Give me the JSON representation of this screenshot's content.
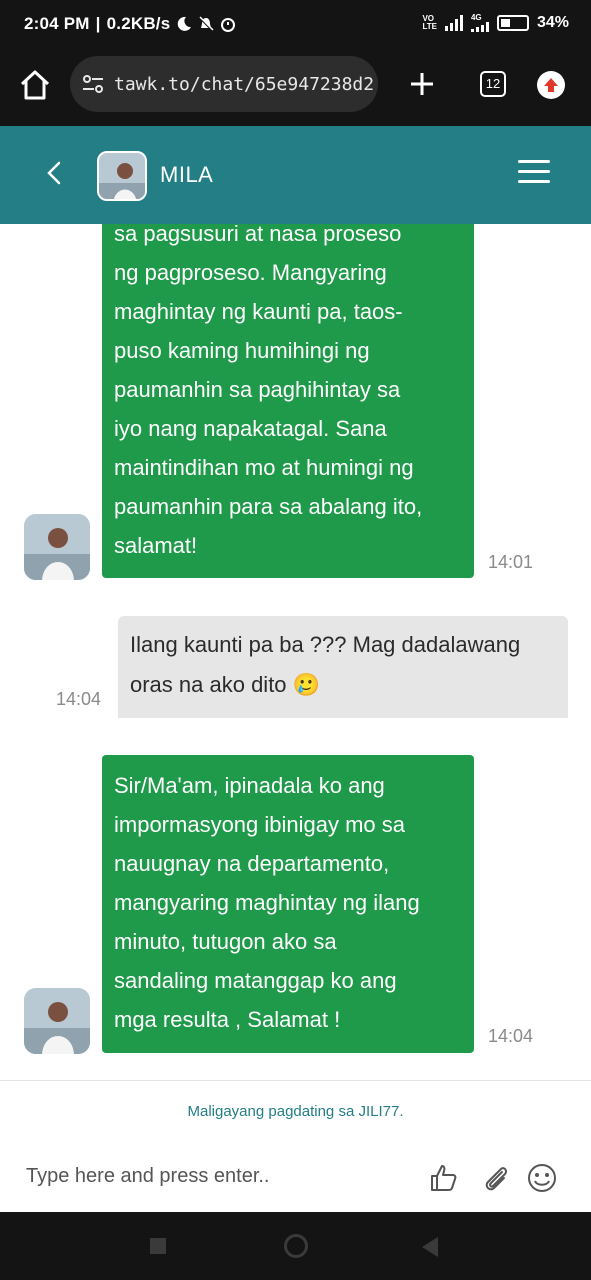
{
  "status_bar": {
    "time": "2:04 PM",
    "net_speed": "0.2KB/s",
    "network_badge_top": "VO",
    "network_badge_bottom": "LTE",
    "lte_label": "4G",
    "battery": "34%"
  },
  "browser": {
    "url": "tawk.to/chat/65e947238d2",
    "tab_count": "12"
  },
  "chat": {
    "agent_name": "MILA",
    "messages": [
      {
        "sender": "agent",
        "lines": [
          "sa pagsusuri at nasa proseso",
          "ng pagproseso. Mangyaring",
          "maghintay ng kaunti pa, taos-",
          "puso kaming humihingi ng",
          "paumanhin sa paghihintay sa",
          "iyo nang napakatagal. Sana",
          "maintindihan mo at humingi ng",
          "paumanhin para sa abalang ito,",
          "salamat!"
        ],
        "time": "14:01"
      },
      {
        "sender": "user",
        "lines": [
          "Ilang kaunti pa ba ??? Mag dadalawang",
          "oras na ako dito 🥲"
        ],
        "time": "14:04"
      },
      {
        "sender": "agent",
        "lines": [
          "Sir/Ma'am, ipinadala ko ang",
          "impormasyong ibinigay mo sa",
          "nauugnay na departamento,",
          "mangyaring maghintay ng ilang",
          "minuto, tutugon ako sa",
          "sandaling matanggap ko ang",
          "mga resulta , Salamat !"
        ],
        "time": "14:04"
      }
    ],
    "welcome_text": "Maligayang pagdating sa JILI77.",
    "input_placeholder": "Type here and press enter.."
  },
  "colors": {
    "header_teal": "#237e86",
    "agent_bubble_green": "#1f9a4a",
    "user_bubble_gray": "#e6e6e6"
  },
  "icons": [
    "home-icon",
    "site-settings-icon",
    "plus-icon",
    "tabs-icon",
    "update-icon",
    "back-arrow-icon",
    "hamburger-menu-icon",
    "thumbs-up-icon",
    "paperclip-icon",
    "emoji-icon"
  ]
}
